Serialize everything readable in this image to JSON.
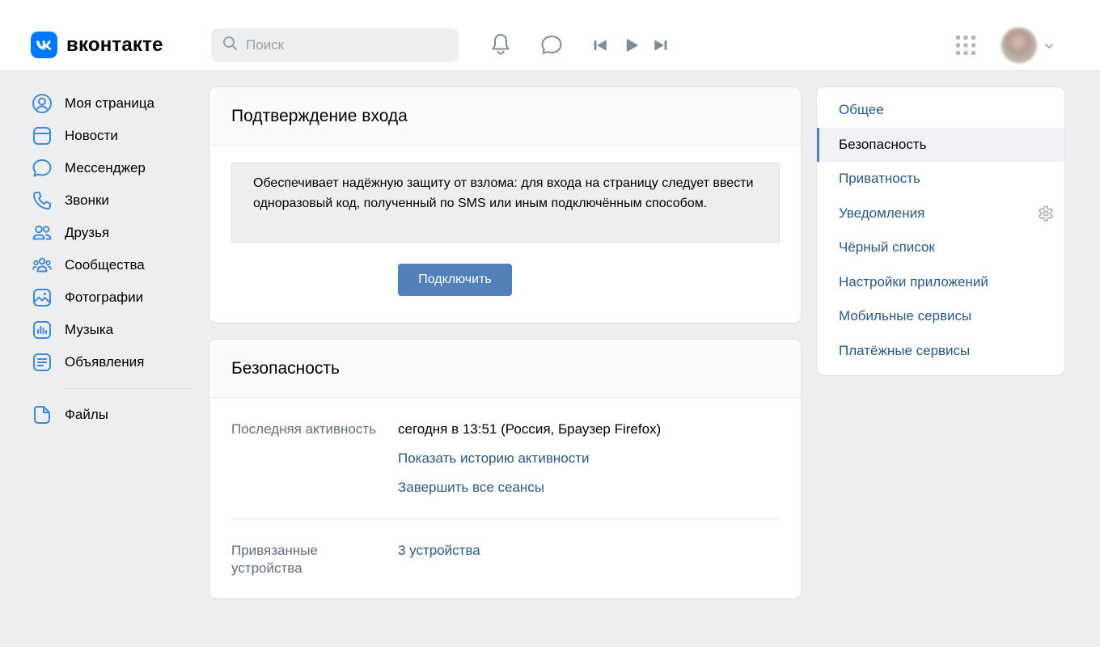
{
  "header": {
    "logo_text": "вконтакте",
    "search_placeholder": "Поиск",
    "icons": [
      "bell-icon",
      "chat-bubble-icon",
      "previous-track-icon",
      "play-icon",
      "next-track-icon",
      "apps-grid-icon",
      "chevron-down-icon"
    ]
  },
  "sidebar": {
    "items": [
      {
        "label": "Моя страница",
        "icon": "user-circle-icon"
      },
      {
        "label": "Новости",
        "icon": "newsfeed-icon"
      },
      {
        "label": "Мессенджер",
        "icon": "message-icon"
      },
      {
        "label": "Звонки",
        "icon": "phone-icon"
      },
      {
        "label": "Друзья",
        "icon": "friends-icon"
      },
      {
        "label": "Сообщества",
        "icon": "communities-icon"
      },
      {
        "label": "Фотографии",
        "icon": "photos-icon"
      },
      {
        "label": "Музыка",
        "icon": "music-icon"
      },
      {
        "label": "Объявления",
        "icon": "ads-icon"
      }
    ],
    "files": {
      "label": "Файлы",
      "icon": "files-icon"
    }
  },
  "login_confirm": {
    "title": "Подтверждение входа",
    "description": "Обеспечивает надёжную защиту от взлома: для входа на страницу следует ввести одноразовый код, полученный по SMS или иным подключённым способом.",
    "button_label": "Подключить"
  },
  "security": {
    "title": "Безопасность",
    "last_activity_label": "Последняя активность",
    "last_activity_value": "сегодня в 13:51 (Россия, Браузер Firefox)",
    "show_history_link": "Показать историю активности",
    "end_sessions_link": "Завершить все сеансы",
    "devices_label": "Привязанные устройства",
    "devices_value": "3 устройства"
  },
  "settings_menu": {
    "items": [
      {
        "label": "Общее",
        "active": false
      },
      {
        "label": "Безопасность",
        "active": true
      },
      {
        "label": "Приватность",
        "active": false
      },
      {
        "label": "Уведомления",
        "active": false
      },
      {
        "label": "Чёрный список",
        "active": false
      },
      {
        "label": "Настройки приложений",
        "active": false
      },
      {
        "label": "Мобильные сервисы",
        "active": false
      },
      {
        "label": "Платёжные сервисы",
        "active": false
      }
    ]
  },
  "colors": {
    "brand": "#0077ff",
    "accent": "#5181b8",
    "link": "#2a5885",
    "background": "#edeef0"
  }
}
